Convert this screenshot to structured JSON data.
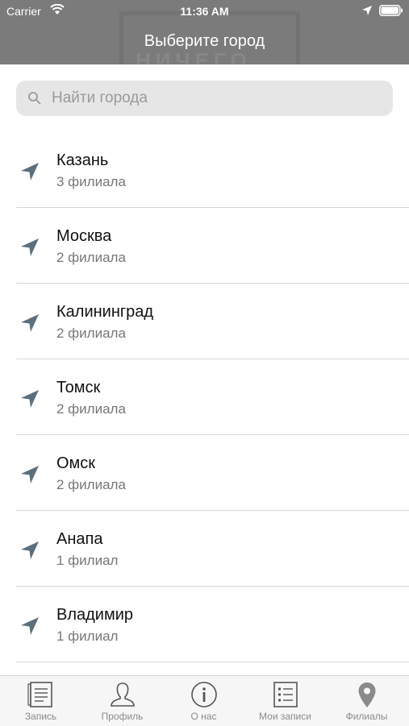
{
  "status_bar": {
    "carrier": "Carrier",
    "time": "11:36 AM"
  },
  "header": {
    "title": "Выберите город",
    "background_text": "НИЧЕГО"
  },
  "search": {
    "placeholder": "Найти города",
    "value": ""
  },
  "cities": [
    {
      "name": "Казань",
      "branches": "3 филиала"
    },
    {
      "name": "Москва",
      "branches": "2 филиала"
    },
    {
      "name": "Калининград",
      "branches": "2 филиала"
    },
    {
      "name": "Томск",
      "branches": "2 филиала"
    },
    {
      "name": "Омск",
      "branches": "2 филиала"
    },
    {
      "name": "Анапа",
      "branches": "1 филиал"
    },
    {
      "name": "Владимир",
      "branches": "1 филиал"
    }
  ],
  "tabbar": {
    "tabs": [
      {
        "label": "Запись",
        "icon": "document-icon"
      },
      {
        "label": "Профиль",
        "icon": "person-icon"
      },
      {
        "label": "О нас",
        "icon": "info-icon"
      },
      {
        "label": "Мои записи",
        "icon": "list-icon"
      },
      {
        "label": "Филиалы",
        "icon": "map-pin-icon",
        "selected": true
      }
    ]
  },
  "colors": {
    "header": "#7b7b7b",
    "arrow": "#5e6f7c",
    "search_bg": "#e6e6e6",
    "divider": "#d8d8d8"
  }
}
